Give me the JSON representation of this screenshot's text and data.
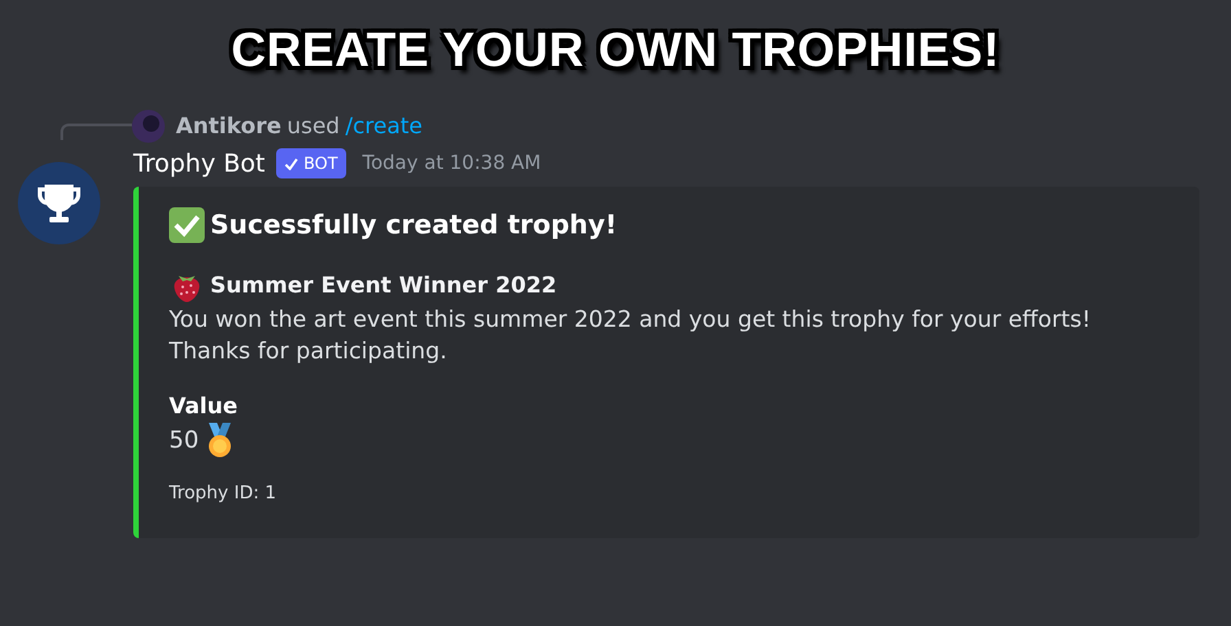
{
  "banner": {
    "title": "CREATE YOUR OWN TROPHIES!"
  },
  "reply": {
    "user": "Antikore",
    "verb": "used",
    "command": "/create"
  },
  "message": {
    "author": "Trophy Bot",
    "badge": "BOT",
    "timestamp": "Today at 10:38 AM"
  },
  "embed": {
    "title": "Sucessfully created trophy!",
    "trophy_name": "Summer Event Winner 2022",
    "description": "You won the art event this summer 2022 and you get this trophy for your efforts! Thanks for participating.",
    "fields": [
      {
        "name": "Value",
        "value": "50"
      }
    ],
    "footer": "Trophy ID: 1"
  }
}
